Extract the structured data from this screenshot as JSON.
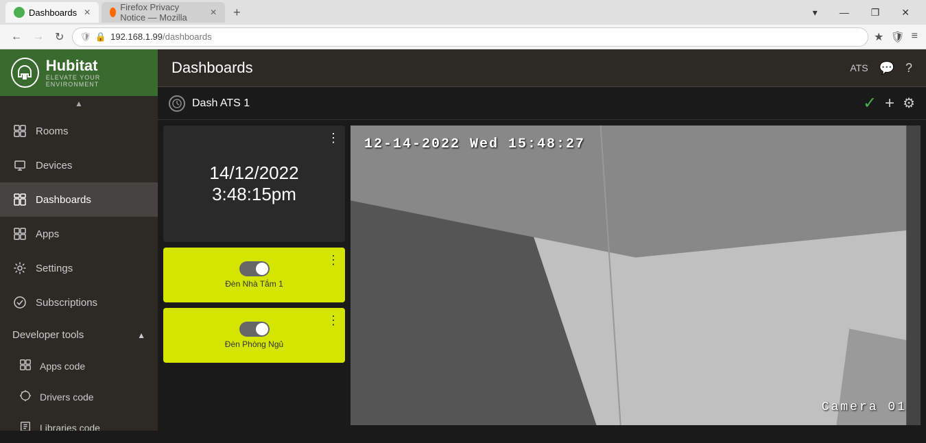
{
  "browser": {
    "tabs": [
      {
        "id": "tab-dashboards",
        "label": "Dashboards",
        "favicon_type": "hubitat",
        "active": true
      },
      {
        "id": "tab-firefox",
        "label": "Firefox Privacy Notice — Mozilla",
        "favicon_type": "firefox",
        "active": false
      }
    ],
    "new_tab_label": "+",
    "window_controls": [
      "▾",
      "—",
      "❐",
      "✕"
    ],
    "address": "192.168.1.99/dashboards",
    "address_domain": "192.168.1.99",
    "address_path": "/dashboards",
    "toolbar_icons": [
      "★",
      "🛡",
      "≡"
    ]
  },
  "sidebar": {
    "logo": {
      "name": "Hubitat",
      "tagline": "Elevate Your Environment"
    },
    "nav_items": [
      {
        "id": "rooms",
        "label": "Rooms",
        "icon": "grid"
      },
      {
        "id": "devices",
        "label": "Devices",
        "icon": "device"
      },
      {
        "id": "dashboards",
        "label": "Dashboards",
        "icon": "dashboard",
        "active": true
      },
      {
        "id": "apps",
        "label": "Apps",
        "icon": "apps"
      },
      {
        "id": "settings",
        "label": "Settings",
        "icon": "settings"
      },
      {
        "id": "subscriptions",
        "label": "Subscriptions",
        "icon": "circle-check"
      }
    ],
    "developer_tools": {
      "label": "Developer tools",
      "expanded": true,
      "items": [
        {
          "id": "apps-code",
          "label": "Apps code",
          "icon": "grid"
        },
        {
          "id": "drivers-code",
          "label": "Drivers code",
          "icon": "sun"
        },
        {
          "id": "libraries-code",
          "label": "Libraries code",
          "icon": "tools"
        }
      ]
    }
  },
  "header": {
    "title": "Dashboards",
    "user": "ATS",
    "icons": [
      "chat",
      "help"
    ]
  },
  "dashboard": {
    "name": "Dash ATS 1",
    "actions": {
      "check": "✓",
      "plus": "+",
      "gear": "⚙"
    },
    "tiles": [
      {
        "id": "clock",
        "type": "clock",
        "date": "14/12/2022",
        "time": "3:48:15pm"
      },
      {
        "id": "light1",
        "type": "light",
        "label": "Đèn Nhà Tắm 1",
        "state": "on"
      },
      {
        "id": "light2",
        "type": "light",
        "label": "Đèn Phòng Ngủ",
        "state": "on"
      }
    ],
    "camera": {
      "timestamp": "12-14-2022 Wed 15:48:27",
      "label": "Camera  01"
    }
  }
}
